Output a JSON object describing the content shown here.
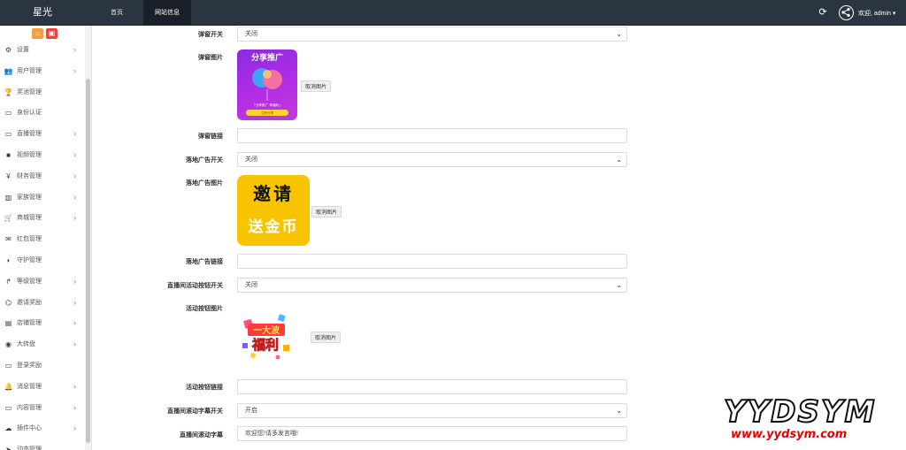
{
  "header": {
    "brand": "星光",
    "tabs": [
      {
        "label": "首页"
      },
      {
        "label": "网站信息"
      }
    ],
    "welcome": "欢迎, admin ▾"
  },
  "sidebar": {
    "items": [
      {
        "label": "设置",
        "icon": "gears-icon",
        "arrow": true
      },
      {
        "label": "用户管理",
        "icon": "users-icon",
        "arrow": true
      },
      {
        "label": "奖池管理",
        "icon": "trophy-icon",
        "arrow": false
      },
      {
        "label": "身份认证",
        "icon": "monitor-icon",
        "arrow": false
      },
      {
        "label": "直播管理",
        "icon": "monitor-icon",
        "arrow": true
      },
      {
        "label": "视频管理",
        "icon": "video-camera-icon",
        "arrow": true
      },
      {
        "label": "财务管理",
        "icon": "yen-icon",
        "arrow": true
      },
      {
        "label": "家族管理",
        "icon": "institution-icon",
        "arrow": true
      },
      {
        "label": "商城管理",
        "icon": "cart-icon",
        "arrow": true
      },
      {
        "label": "红包管理",
        "icon": "envelope-icon",
        "arrow": false
      },
      {
        "label": "守护管理",
        "icon": "shield-icon",
        "arrow": false
      },
      {
        "label": "等级管理",
        "icon": "level-up-icon",
        "arrow": true
      },
      {
        "label": "邀请奖励",
        "icon": "sitemap-icon",
        "arrow": true
      },
      {
        "label": "店铺管理",
        "icon": "store-icon",
        "arrow": true
      },
      {
        "label": "大转盘",
        "icon": "gamepad-icon",
        "arrow": true
      },
      {
        "label": "登录奖励",
        "icon": "monitor-icon",
        "arrow": false
      },
      {
        "label": "消息管理",
        "icon": "bell-icon",
        "arrow": true
      },
      {
        "label": "内容管理",
        "icon": "monitor-icon",
        "arrow": true
      },
      {
        "label": "插件中心",
        "icon": "cloud-icon",
        "arrow": true
      },
      {
        "label": "动态管理",
        "icon": "send-icon",
        "arrow": false
      }
    ]
  },
  "form": {
    "popup_switch": {
      "label": "弹窗开关",
      "value": "关闭"
    },
    "popup_image": {
      "label": "弹窗图片",
      "cancel": "取消图片",
      "poster_title": "分享推广",
      "poster_caption": "「分享推广  享福利」",
      "poster_button": "立即分享"
    },
    "popup_link": {
      "label": "弹窗链接",
      "value": ""
    },
    "landing_switch": {
      "label": "落地广告开关",
      "value": "关闭"
    },
    "landing_image": {
      "label": "落地广告图片",
      "cancel": "取消图片",
      "line1": "邀请",
      "line2": "送金币"
    },
    "landing_link": {
      "label": "落地广告链接",
      "value": ""
    },
    "activity_switch": {
      "label": "直播间活动按钮开关",
      "value": "关闭"
    },
    "activity_image": {
      "label": "活动按钮图片",
      "cancel": "取消图片",
      "top": "一大波",
      "bottom": "福利"
    },
    "activity_link": {
      "label": "活动按钮链接",
      "value": ""
    },
    "marquee_switch": {
      "label": "直播间滚动字幕开关",
      "value": "开启"
    },
    "marquee_text": {
      "label": "直播间滚动字幕",
      "value": "欢迎您!请多发言哦!"
    }
  },
  "watermark": {
    "big": "YYDSYM",
    "url": "www.yydsym.com"
  },
  "colors": {
    "topbar": "#2b3542",
    "active_tab": "#1a2029",
    "tool_orange": "#f0a13c",
    "tool_red": "#e2483e",
    "watermark_red": "#e60000"
  }
}
